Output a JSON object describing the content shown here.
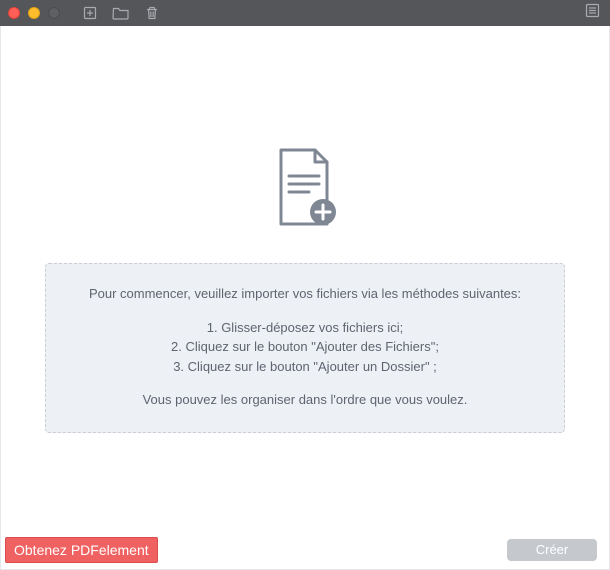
{
  "infobox": {
    "heading": "Pour commencer, veuillez importer vos fichiers via les méthodes suivantes:",
    "step1": "1. Glisser-déposez vos fichiers ici;",
    "step2": "2. Cliquez sur le bouton \"Ajouter des Fichiers\";",
    "step3": "3. Cliquez sur le bouton \"Ajouter un Dossier\" ;",
    "footer": "Vous pouvez les organiser dans l'ordre que vous voulez."
  },
  "buttons": {
    "promo": "Obtenez PDFelement",
    "create": "Créer"
  },
  "colors": {
    "titlebar": "#54565a",
    "promo": "#f06262",
    "infobox_bg": "#edf0f4",
    "create_disabled": "#c5c9ce"
  },
  "icons": {
    "add_file": "add-file-icon",
    "folder": "folder-icon",
    "trash": "trash-icon",
    "panel": "panel-icon",
    "document_add": "document-add-icon"
  }
}
